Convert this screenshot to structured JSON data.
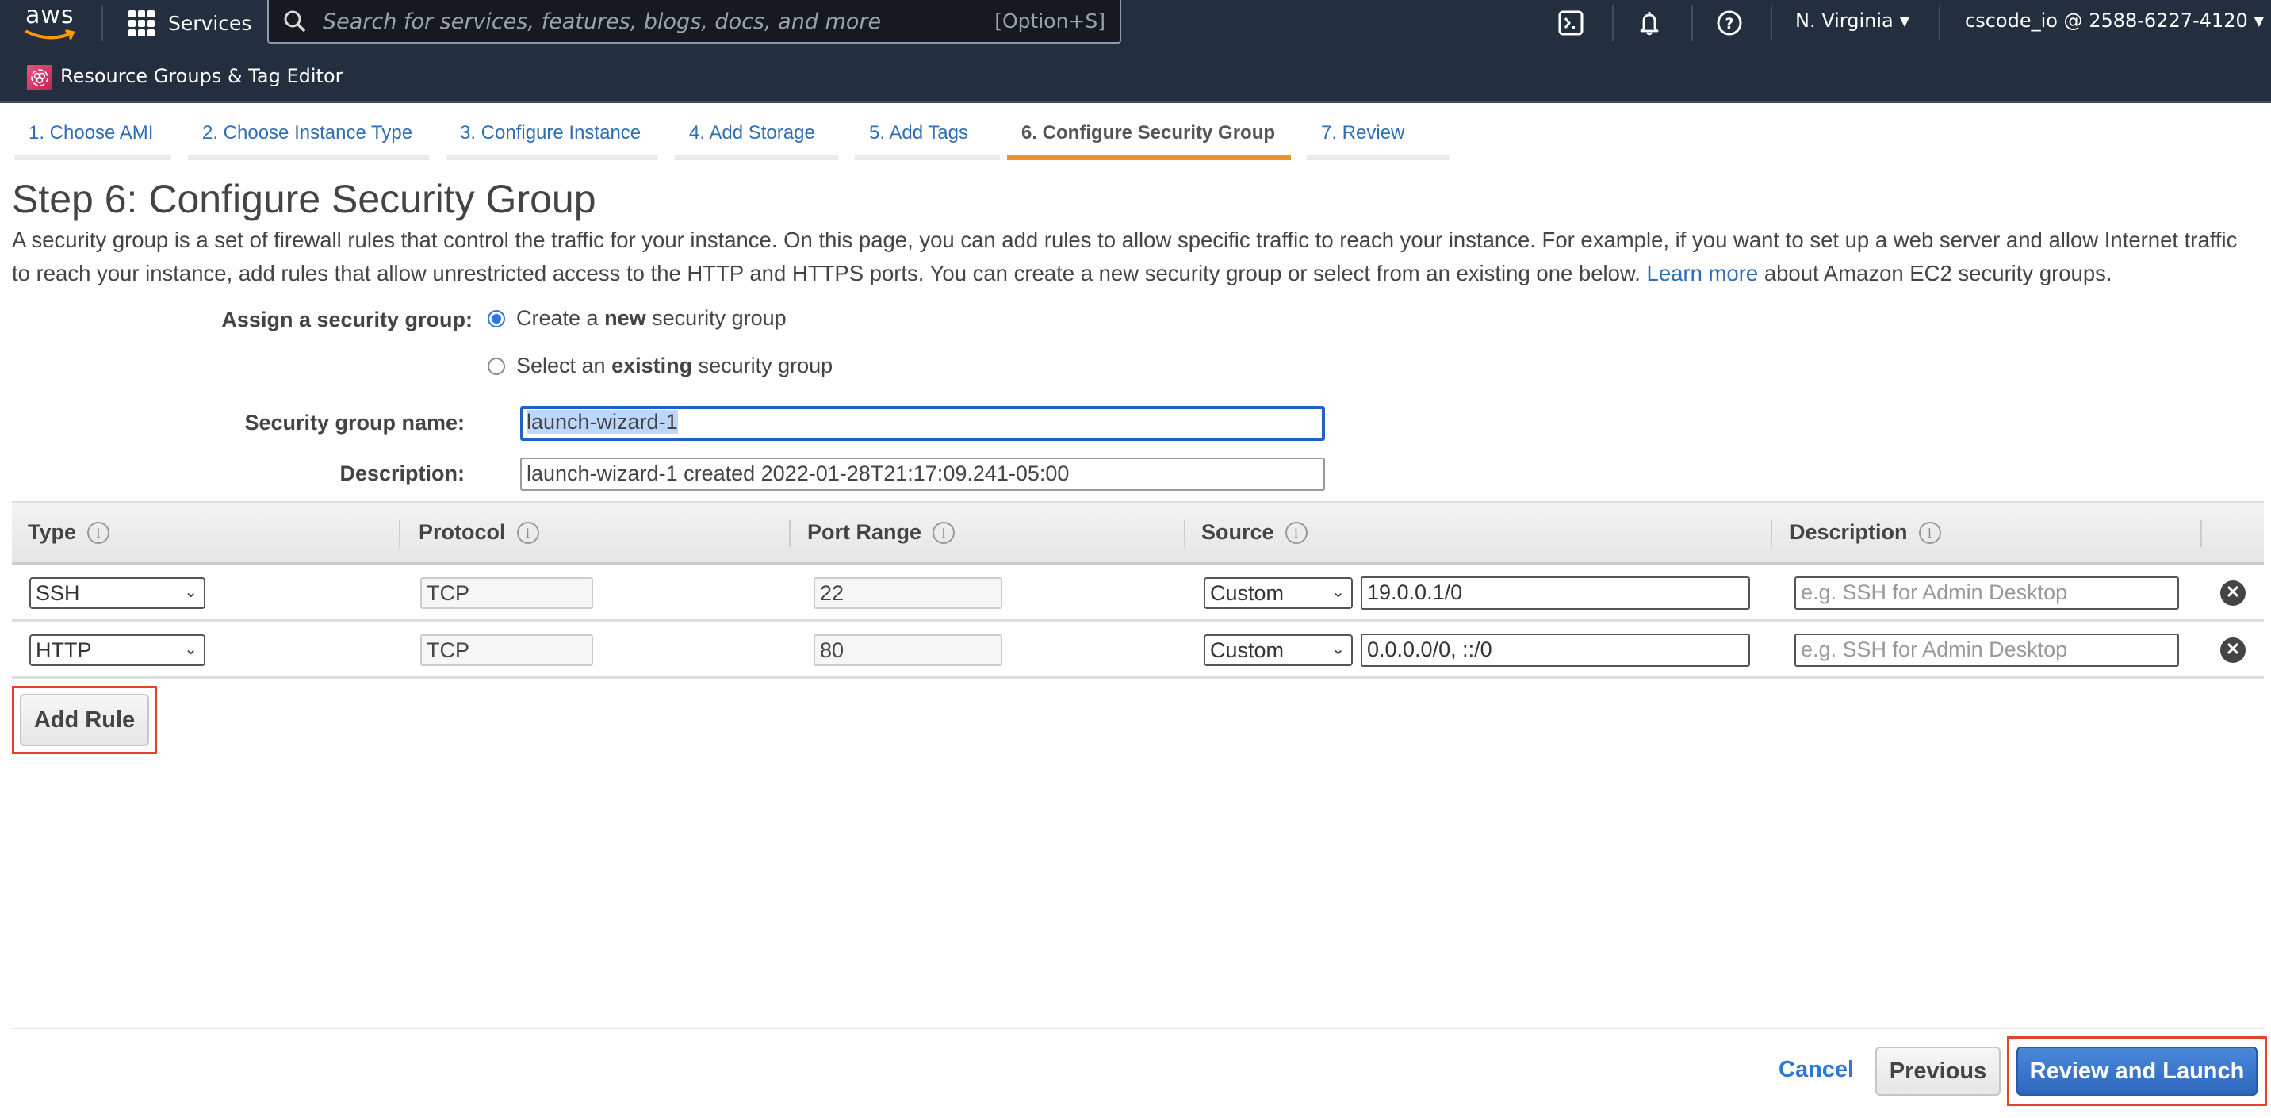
{
  "topnav": {
    "logo": "aws",
    "services_label": "Services",
    "search_placeholder": "Search for services, features, blogs, docs, and more",
    "search_shortcut": "[Option+S]",
    "icons": [
      "cloudshell-icon",
      "bell-icon",
      "help-icon"
    ],
    "region": "N. Virginia",
    "account": "cscode_io @ 2588-6227-4120",
    "service_shortcut": "Resource Groups & Tag Editor"
  },
  "wizard": {
    "tabs": [
      {
        "label": "1. Choose AMI",
        "active": false
      },
      {
        "label": "2. Choose Instance Type",
        "active": false
      },
      {
        "label": "3. Configure Instance",
        "active": false
      },
      {
        "label": "4. Add Storage",
        "active": false
      },
      {
        "label": "5. Add Tags",
        "active": false
      },
      {
        "label": "6. Configure Security Group",
        "active": true
      },
      {
        "label": "7. Review",
        "active": false
      }
    ],
    "accent_color": "#ec912d"
  },
  "page": {
    "title": "Step 6: Configure Security Group",
    "intro_part1": "A security group is a set of firewall rules that control the traffic for your instance. On this page, you can add rules to allow specific traffic to reach your instance. For example, if you want to set up a web server and allow Internet traffic to reach your instance, add rules that allow unrestricted access to the HTTP and HTTPS ports. You can create a new security group or select from an existing one below.",
    "intro_link": "Learn more",
    "intro_part2": "about Amazon EC2 security groups."
  },
  "form": {
    "assign_label": "Assign a security group:",
    "option_new": {
      "pre": "Create a ",
      "bold": "new",
      "post": " security group",
      "checked": true
    },
    "option_existing": {
      "pre": "Select an ",
      "bold": "existing",
      "post": " security group",
      "checked": false
    },
    "name_label": "Security group name:",
    "name_value": "launch-wizard-1",
    "description_label": "Description:",
    "description_value": "launch-wizard-1 created 2022-01-28T21:17:09.241-05:00"
  },
  "rules": {
    "columns": [
      "Type",
      "Protocol",
      "Port Range",
      "Source",
      "Description"
    ],
    "rows": [
      {
        "type": "SSH",
        "protocol": "TCP",
        "port_range": "22",
        "source_type": "Custom",
        "source_value": "19.0.0.1/0",
        "description_placeholder": "e.g. SSH for Admin Desktop"
      },
      {
        "type": "HTTP",
        "protocol": "TCP",
        "port_range": "80",
        "source_type": "Custom",
        "source_value": "0.0.0.0/0, ::/0",
        "description_placeholder": "e.g. SSH for Admin Desktop"
      }
    ],
    "add_rule_label": "Add Rule"
  },
  "footer": {
    "cancel_label": "Cancel",
    "previous_label": "Previous",
    "review_launch_label": "Review and Launch"
  }
}
